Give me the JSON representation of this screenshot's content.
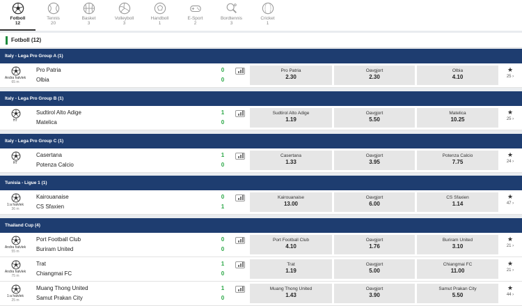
{
  "tabs": [
    {
      "name": "Fotboll",
      "count": "12",
      "icon": "soccer-ball-icon",
      "active": true
    },
    {
      "name": "Tennis",
      "count": "20",
      "icon": "tennis-ball-icon"
    },
    {
      "name": "Basket",
      "count": "3",
      "icon": "basketball-icon"
    },
    {
      "name": "Volleyboll",
      "count": "3",
      "icon": "volleyball-icon"
    },
    {
      "name": "Handboll",
      "count": "1",
      "icon": "handball-icon"
    },
    {
      "name": "E-Sport",
      "count": "2",
      "icon": "gamepad-icon"
    },
    {
      "name": "Bordtennis",
      "count": "3",
      "icon": "table-tennis-icon"
    },
    {
      "name": "Cricket",
      "count": "1",
      "icon": "cricket-ball-icon"
    }
  ],
  "section": {
    "title": "Fotboll  (12)"
  },
  "leagues": [
    {
      "title": "Italy - Lega Pro Group A (1)"
    },
    {
      "title": "Italy - Lega Pro Group B (1)"
    },
    {
      "title": "Italy - Lega Pro Group C (1)"
    },
    {
      "title": "Tunisia - Ligue 1 (1)"
    },
    {
      "title": "Thailand Cup (4)"
    }
  ],
  "matches": [
    {
      "home": "Pro Patria",
      "away": "Olbia",
      "home_score": "0",
      "away_score": "0",
      "status": "Andra halvlek",
      "minute": "65 m",
      "odds": [
        {
          "label": "Pro Patria",
          "value": "2.30"
        },
        {
          "label": "Oavgjort",
          "value": "2.30"
        },
        {
          "label": "Olbia",
          "value": "4.10"
        }
      ],
      "more": "25"
    },
    {
      "home": "Sudtirol Alto Adige",
      "away": "Matelica",
      "home_score": "1",
      "away_score": "0",
      "status": "HT",
      "minute": "",
      "odds": [
        {
          "label": "Sudtirol Alto Adige",
          "value": "1.19"
        },
        {
          "label": "Oavgjort",
          "value": "5.50"
        },
        {
          "label": "Matelica",
          "value": "10.25"
        }
      ],
      "more": "25"
    },
    {
      "home": "Casertana",
      "away": "Potenza Calcio",
      "home_score": "1",
      "away_score": "0",
      "status": "HT",
      "minute": "",
      "odds": [
        {
          "label": "Casertana",
          "value": "1.33"
        },
        {
          "label": "Oavgjort",
          "value": "3.95"
        },
        {
          "label": "Potenza Calcio",
          "value": "7.75"
        }
      ],
      "more": "24"
    },
    {
      "home": "Kairouanaise",
      "away": "CS Sfaxien",
      "home_score": "0",
      "away_score": "1",
      "status": "1:a halvlek",
      "minute": "36 m",
      "odds": [
        {
          "label": "Kairouanaise",
          "value": "13.00"
        },
        {
          "label": "Oavgjort",
          "value": "6.00"
        },
        {
          "label": "CS Sfaxien",
          "value": "1.14"
        }
      ],
      "more": "47"
    },
    {
      "home": "Port Football Club",
      "away": "Buriram United",
      "home_score": "0",
      "away_score": "0",
      "status": "Andra halvlek",
      "minute": "55 m",
      "odds": [
        {
          "label": "Port Football Club",
          "value": "4.10"
        },
        {
          "label": "Oavgjort",
          "value": "1.76"
        },
        {
          "label": "Buriram United",
          "value": "3.10"
        }
      ],
      "more": "21"
    },
    {
      "home": "Trat",
      "away": "Chiangmai FC",
      "home_score": "1",
      "away_score": "0",
      "status": "Andra halvlek",
      "minute": "75 m",
      "odds": [
        {
          "label": "Trat",
          "value": "1.19"
        },
        {
          "label": "Oavgjort",
          "value": "5.00"
        },
        {
          "label": "Chiangmai FC",
          "value": "11.00"
        }
      ],
      "more": "21"
    },
    {
      "home": "Muang Thong United",
      "away": "Samut Prakan City",
      "home_score": "1",
      "away_score": "0",
      "status": "1:a halvlek",
      "minute": "25 m",
      "odds": [
        {
          "label": "Muang Thong United",
          "value": "1.43"
        },
        {
          "label": "Oavgjort",
          "value": "3.90"
        },
        {
          "label": "Samut Prakan City",
          "value": "5.50"
        }
      ],
      "more": "44"
    }
  ],
  "colors": {
    "league_bg": "#1e3d70",
    "score": "#2aa745",
    "accent": "#1c8a3b",
    "odds_bg": "#e6e6e6"
  }
}
